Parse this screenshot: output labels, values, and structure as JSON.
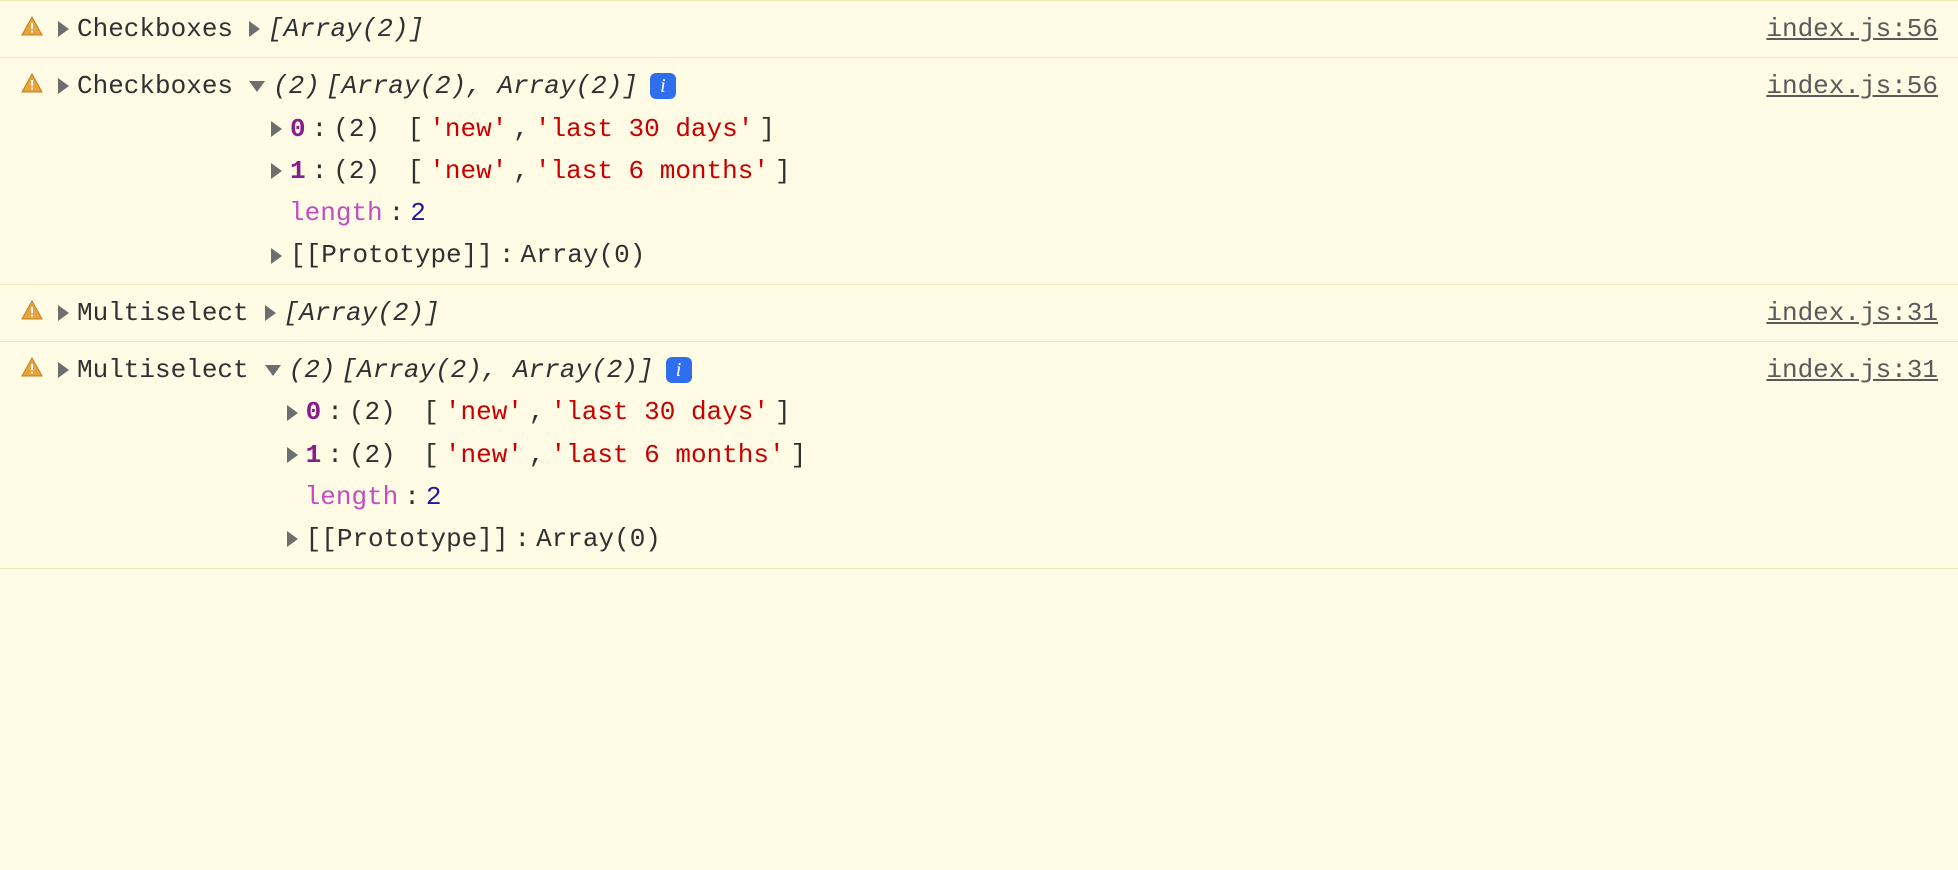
{
  "rows": [
    {
      "label": "Checkboxes",
      "expanded": false,
      "preview": "[Array(2)]",
      "source": "index.js:56"
    },
    {
      "label": "Checkboxes",
      "expanded": true,
      "count": "(2)",
      "preview": "[Array(2), Array(2)]",
      "info": "i",
      "children": {
        "items": [
          {
            "idx": "0",
            "count": "(2)",
            "open": "[",
            "v0": "'new'",
            "sep": ", ",
            "v1": "'last 30 days'",
            "close": "]"
          },
          {
            "idx": "1",
            "count": "(2)",
            "open": "[",
            "v0": "'new'",
            "sep": ", ",
            "v1": "'last 6 months'",
            "close": "]"
          }
        ],
        "length_key": "length",
        "length_val": "2",
        "proto_key": "[[Prototype]]",
        "proto_val": "Array(0)"
      },
      "source": "index.js:56"
    },
    {
      "label": "Multiselect",
      "expanded": false,
      "preview": "[Array(2)]",
      "source": "index.js:31"
    },
    {
      "label": "Multiselect",
      "expanded": true,
      "count": "(2)",
      "preview": "[Array(2), Array(2)]",
      "info": "i",
      "children": {
        "items": [
          {
            "idx": "0",
            "count": "(2)",
            "open": "[",
            "v0": "'new'",
            "sep": ", ",
            "v1": "'last 30 days'",
            "close": "]"
          },
          {
            "idx": "1",
            "count": "(2)",
            "open": "[",
            "v0": "'new'",
            "sep": ", ",
            "v1": "'last 6 months'",
            "close": "]"
          }
        ],
        "length_key": "length",
        "length_val": "2",
        "proto_key": "[[Prototype]]",
        "proto_val": "Array(0)"
      },
      "source": "index.js:31"
    }
  ],
  "colon": ":",
  "colon_sp": ": "
}
